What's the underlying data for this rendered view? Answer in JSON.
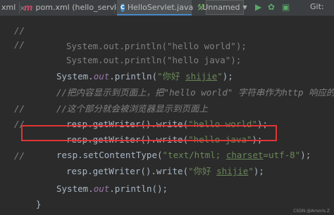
{
  "tabs": [
    {
      "label": "xml",
      "icon": "none",
      "close": "×"
    },
    {
      "label": "pom.xml (hello_servlet)",
      "icon": "maven-m-icon",
      "close": "×"
    },
    {
      "label": "HelloServlet.java",
      "icon": "java-class-icon",
      "close": "×"
    }
  ],
  "toolbar": {
    "run_config": "Unnamed",
    "git": "Git:"
  },
  "code_lines": [
    {
      "gutter": "//",
      "code": "System.out.println(\"hello world\");"
    },
    {
      "gutter": "//",
      "code": "System.out.println(\"hello java\");"
    },
    {
      "gutter": "",
      "code_parts": [
        "System.",
        "out",
        ".println(",
        "\"你好 ",
        "shijie",
        "\"",
        ");"
      ]
    },
    {
      "gutter": "",
      "code": "//把内容显示到页面上，把\"hello world\" 字符串作为http 响应的bod"
    },
    {
      "gutter": "",
      "code": "//这个部分就会被浏览器显示到页面上"
    },
    {
      "gutter": "//",
      "code_parts": [
        "resp.getWriter().write(",
        "\"hello world\"",
        ");"
      ]
    },
    {
      "gutter": "//",
      "code_parts": [
        "resp.getWriter().write(",
        "\"hello java\"",
        ");"
      ]
    },
    {
      "gutter": "",
      "code_parts": [
        "resp.setContentType(",
        "\"text/html; ",
        "charset",
        "=utf-8\"",
        ");"
      ]
    },
    {
      "gutter": "//",
      "code_parts": [
        "resp.getWriter().write(",
        "\"你好 ",
        "shijie",
        "\"",
        ");"
      ]
    },
    {
      "gutter": "",
      "code_parts": [
        "System.",
        "out",
        ".println();"
      ]
    },
    {
      "gutter": "",
      "code": "}"
    }
  ],
  "watermark": "CSDN @Amoris Z",
  "colors": {
    "background": "#2b2b2b",
    "string": "#6a8759",
    "field": "#9876aa",
    "comment": "#808080",
    "highlight_border": "#e03535"
  }
}
